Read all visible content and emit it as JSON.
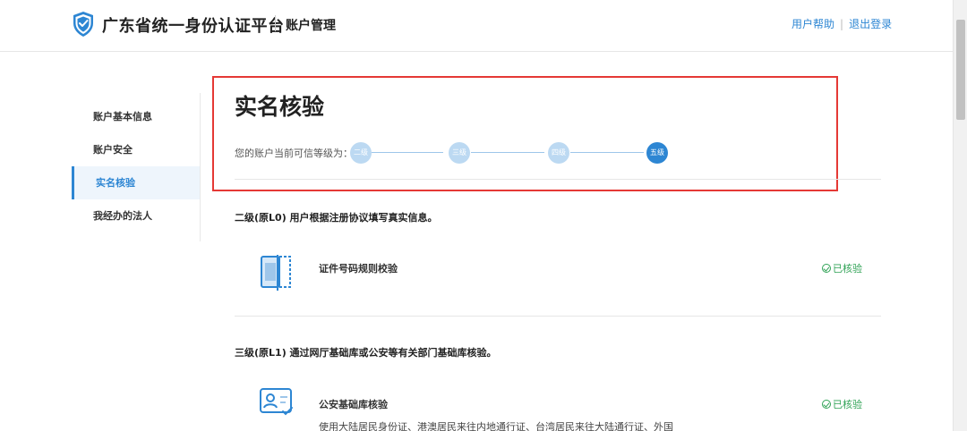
{
  "header": {
    "brand_title": "广东省统一身份认证平台",
    "brand_sub": "账户管理",
    "help_link": "用户帮助",
    "link_separator": "|",
    "logout_link": "退出登录"
  },
  "sidebar": {
    "items": [
      {
        "label": "账户基本信息"
      },
      {
        "label": "账户安全"
      },
      {
        "label": "实名核验"
      },
      {
        "label": "我经办的法人"
      }
    ],
    "active_index": 2
  },
  "main": {
    "title": "实名核验",
    "level_label": "您的账户当前可信等级为：",
    "levels": [
      "二级",
      "三级",
      "四级",
      "五级"
    ],
    "current_level": "五级",
    "sections": [
      {
        "heading": "二级(原L0) 用户根据注册协议填写真实信息。",
        "rows": [
          {
            "title": "证件号码规则校验",
            "status": "已核验",
            "icon": "id-card-scan-icon"
          }
        ]
      },
      {
        "heading": "三级(原L1) 通过网厅基础库或公安等有关部门基础库核验。",
        "rows": [
          {
            "title": "公安基础库核验",
            "status": "已核验",
            "icon": "id-card-check-icon",
            "description": "使用大陆居民身份证、港澳居民来往内地通行证、台湾居民来往大陆通行证、外国"
          }
        ]
      }
    ]
  },
  "colors": {
    "accent": "#2d86d3",
    "step_inactive": "#bcd9f2",
    "verified": "#2fa255",
    "highlight_box": "#e53935"
  }
}
